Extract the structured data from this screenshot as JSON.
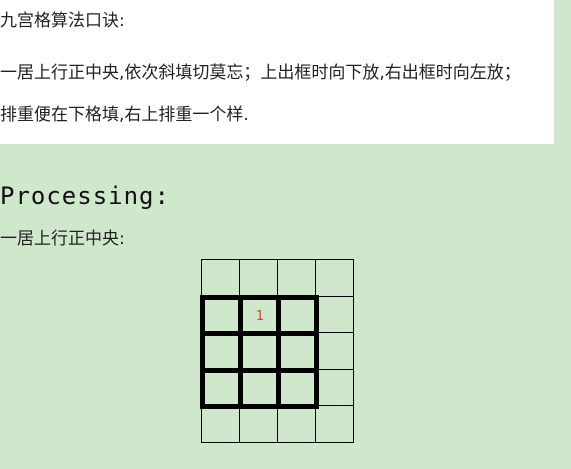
{
  "intro": {
    "title": "九宫格算法口诀:",
    "line1": "一居上行正中央,依次斜填切莫忘；上出框时向下放,右出框时向左放；",
    "line2": "排重便在下格填,右上排重一个样."
  },
  "processing": {
    "title": "Processing:",
    "step_label": "一居上行正中央:"
  },
  "magic_square": {
    "size": 3,
    "filled": [
      {
        "row": 0,
        "col": 1,
        "value": "1"
      }
    ],
    "number_color": "#e8372d"
  },
  "colors": {
    "background": "#cfe8cb",
    "panel": "#ffffff",
    "grid_line": "#000000"
  }
}
